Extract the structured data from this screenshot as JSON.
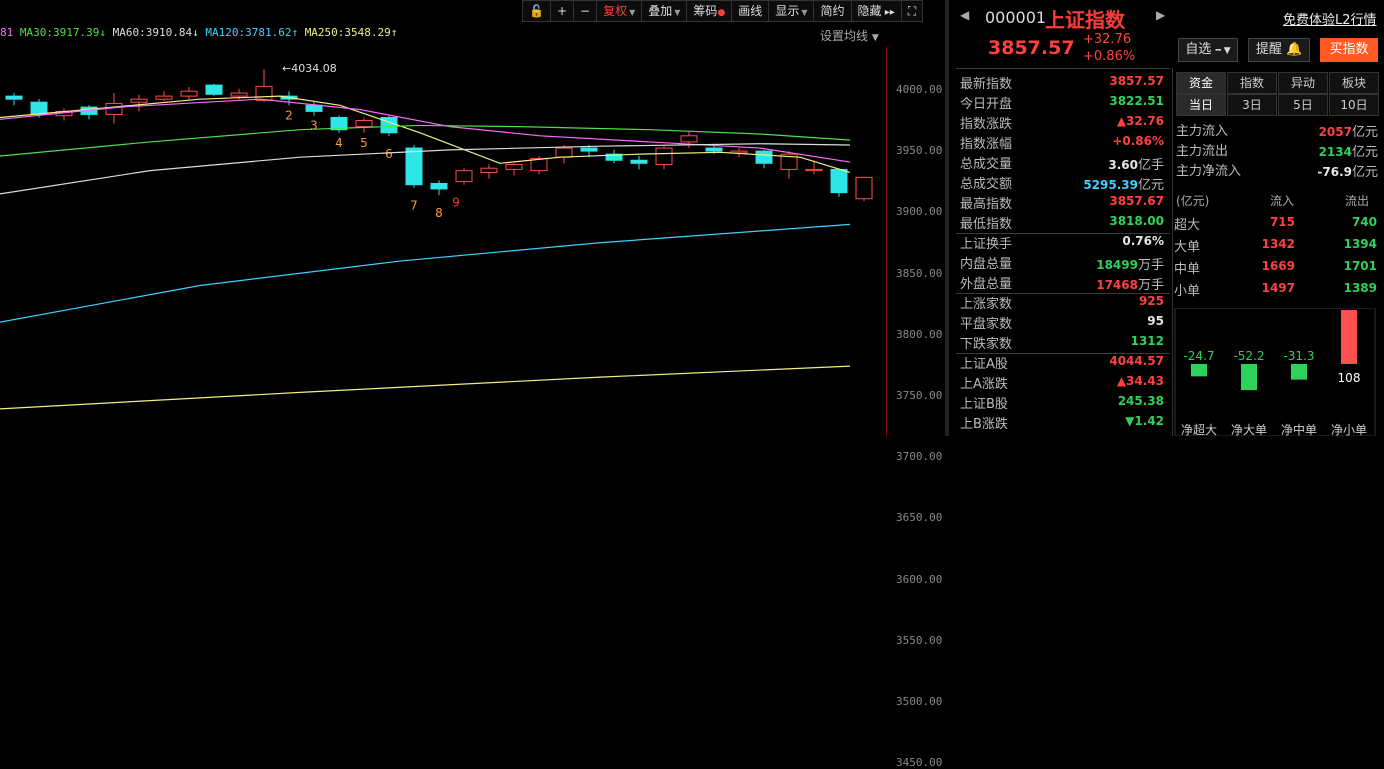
{
  "toolbar": {
    "buttons": [
      "复权",
      "叠加",
      "筹码",
      "画线",
      "显示",
      "简约",
      "隐藏"
    ]
  },
  "ma_bar": [
    {
      "text": "81",
      "color": "#ff69ff"
    },
    {
      "text": "MA30:3917.39",
      "color": "#4ee04e"
    },
    {
      "text": "MA60:3910.84",
      "color": "#dddddd"
    },
    {
      "text": "MA120:3781.62",
      "color": "#3fd0ff"
    },
    {
      "text": "MA250:3548.29",
      "color": "#f0f080"
    }
  ],
  "ma_setting_label": "设置均线",
  "chart": {
    "high_marker": "4034.08",
    "y_ticks": [
      "4000.00",
      "3950.00",
      "3900.00",
      "3850.00",
      "3800.00",
      "3750.00",
      "3700.00",
      "3650.00",
      "3600.00",
      "3550.00",
      "3500.00",
      "3450.00"
    ],
    "count_labels": [
      "2",
      "3",
      "4",
      "5",
      "6",
      "7",
      "8",
      "9"
    ]
  },
  "stock": {
    "code": "000001",
    "name": "上证指数",
    "free_trial": "免费体验L2行情",
    "price": "3857.57",
    "change": "+32.76",
    "change_pct": "+0.86%",
    "watch_btn": "自选",
    "alert_btn": "提醒",
    "buy_btn": "买指数"
  },
  "stats": [
    {
      "label": "最新指数",
      "value": "3857.57",
      "color": "red"
    },
    {
      "label": "今日开盘",
      "value": "3822.51",
      "color": "green"
    },
    {
      "label": "指数涨跌",
      "value": "▲32.76",
      "color": "red"
    },
    {
      "label": "指数涨幅",
      "value": "+0.86%",
      "color": "red"
    },
    {
      "label": "总成交量",
      "value": "3.60",
      "unit": "亿手",
      "color": "white"
    },
    {
      "label": "总成交额",
      "value": "5295.39",
      "unit": "亿元",
      "color": "#3fd0ff"
    },
    {
      "label": "最高指数",
      "value": "3857.67",
      "color": "red"
    },
    {
      "label": "最低指数",
      "value": "3818.00",
      "color": "green"
    },
    {
      "label": "上证换手",
      "value": "0.76%",
      "color": "white"
    },
    {
      "label": "内盘总量",
      "value": "18499",
      "unit": "万手",
      "color": "green"
    },
    {
      "label": "外盘总量",
      "value": "17468",
      "unit": "万手",
      "color": "red"
    },
    {
      "label": "上涨家数",
      "value": "925",
      "color": "red"
    },
    {
      "label": "平盘家数",
      "value": "95",
      "color": "white"
    },
    {
      "label": "下跌家数",
      "value": "1312",
      "color": "green"
    },
    {
      "label": "上证A股",
      "value": "4044.57",
      "color": "red"
    },
    {
      "label": "上A涨跌",
      "value": "▲34.43",
      "color": "red"
    },
    {
      "label": "上证B股",
      "value": "245.38",
      "color": "green"
    },
    {
      "label": "上B涨跌",
      "value": "▼1.42",
      "color": "green"
    }
  ],
  "flow_tabs": [
    "资金",
    "指数",
    "异动",
    "板块"
  ],
  "period_tabs": [
    "当日",
    "3日",
    "5日",
    "10日"
  ],
  "flow": [
    {
      "label": "主力流入",
      "value": "2057",
      "unit": "亿元",
      "color": "red"
    },
    {
      "label": "主力流出",
      "value": "2134",
      "unit": "亿元",
      "color": "green"
    },
    {
      "label": "主力净流入",
      "value": "-76.9",
      "unit": "亿元",
      "color": "white"
    }
  ],
  "flow_table": {
    "headers": [
      "(亿元)",
      "流入",
      "流出"
    ],
    "rows": [
      {
        "label": "超大",
        "in": "715",
        "out": "740"
      },
      {
        "label": "大单",
        "in": "1342",
        "out": "1394"
      },
      {
        "label": "中单",
        "in": "1669",
        "out": "1701"
      },
      {
        "label": "小单",
        "in": "1497",
        "out": "1389"
      }
    ]
  },
  "net_bars": [
    {
      "label": "净超大",
      "value": "-24.7",
      "num": -24.7
    },
    {
      "label": "净大单",
      "value": "-52.2",
      "num": -52.2
    },
    {
      "label": "净中单",
      "value": "-31.3",
      "num": -31.3
    },
    {
      "label": "净小单",
      "value": "108",
      "num": 108
    }
  ],
  "chart_data": {
    "type": "candlestick",
    "ma_series": [
      "MA30",
      "MA60",
      "MA120",
      "MA250"
    ],
    "annotations": [
      "4034.08"
    ]
  }
}
